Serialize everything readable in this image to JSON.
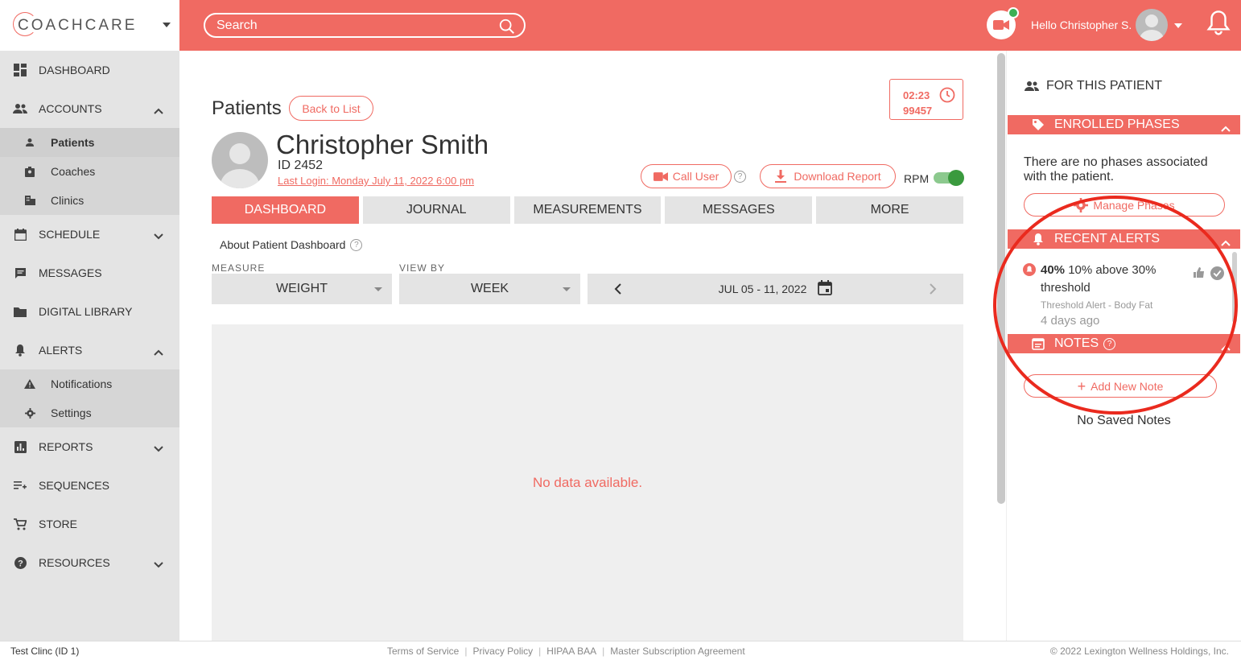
{
  "brand": {
    "logo_text": "COACHCARE",
    "accent": "#f06a62"
  },
  "header": {
    "search_placeholder": "Search",
    "greeting": "Hello Christopher S."
  },
  "sidebar": {
    "items": [
      {
        "label": "DASHBOARD",
        "icon": "dashboard-icon"
      },
      {
        "label": "ACCOUNTS",
        "icon": "people-icon",
        "expanded": true,
        "children": [
          {
            "label": "Patients",
            "icon": "person-icon",
            "active": true
          },
          {
            "label": "Coaches",
            "icon": "badge-icon"
          },
          {
            "label": "Clinics",
            "icon": "building-icon"
          }
        ]
      },
      {
        "label": "SCHEDULE",
        "icon": "calendar-icon",
        "expanded": false
      },
      {
        "label": "MESSAGES",
        "icon": "chat-icon"
      },
      {
        "label": "DIGITAL LIBRARY",
        "icon": "folder-icon"
      },
      {
        "label": "ALERTS",
        "icon": "bell-icon",
        "expanded": true,
        "children": [
          {
            "label": "Notifications",
            "icon": "warning-icon"
          },
          {
            "label": "Settings",
            "icon": "gear-icon"
          }
        ]
      },
      {
        "label": "REPORTS",
        "icon": "bar-chart-icon",
        "expanded": false
      },
      {
        "label": "SEQUENCES",
        "icon": "playlist-icon"
      },
      {
        "label": "STORE",
        "icon": "cart-icon"
      },
      {
        "label": "RESOURCES",
        "icon": "help-icon",
        "expanded": false
      }
    ]
  },
  "main": {
    "page_title": "Patients",
    "back_label": "Back to List",
    "timer": {
      "time": "02:23",
      "code": "99457"
    },
    "patient": {
      "name": "Christopher Smith",
      "id_text": "ID 2452",
      "last_login": "Last Login: Monday July 11, 2022 6:00 pm"
    },
    "call_label": "Call User",
    "download_label": "Download Report",
    "rpm_label": "RPM",
    "rpm_on": true,
    "tabs": [
      "DASHBOARD",
      "JOURNAL",
      "MEASUREMENTS",
      "MESSAGES",
      "MORE"
    ],
    "active_tab": "DASHBOARD",
    "about_label": "About Patient Dashboard",
    "measure_label": "MEASURE",
    "measure_value": "WEIGHT",
    "viewby_label": "VIEW BY",
    "viewby_value": "WEEK",
    "date_range": "JUL 05 - 11, 2022",
    "no_data": "No data available."
  },
  "right_panel": {
    "heading": "FOR THIS PATIENT",
    "enrolled_title": "ENROLLED PHASES",
    "no_phases": "There are no phases associated with the patient.",
    "manage_phases": "Manage Phases",
    "alerts_title": "RECENT ALERTS",
    "alert": {
      "value": "40%",
      "text": "10% above 30% threshold",
      "type": "Threshold Alert - Body Fat",
      "time": "4 days ago"
    },
    "notes_title": "NOTES",
    "add_note": "Add New Note",
    "no_notes": "No Saved Notes"
  },
  "footer": {
    "clinic": "Test Clinc (ID 1)",
    "links": [
      "Terms of Service",
      "Privacy Policy",
      "HIPAA BAA",
      "Master Subscription Agreement"
    ],
    "copyright": "© 2022 Lexington Wellness Holdings, Inc."
  }
}
